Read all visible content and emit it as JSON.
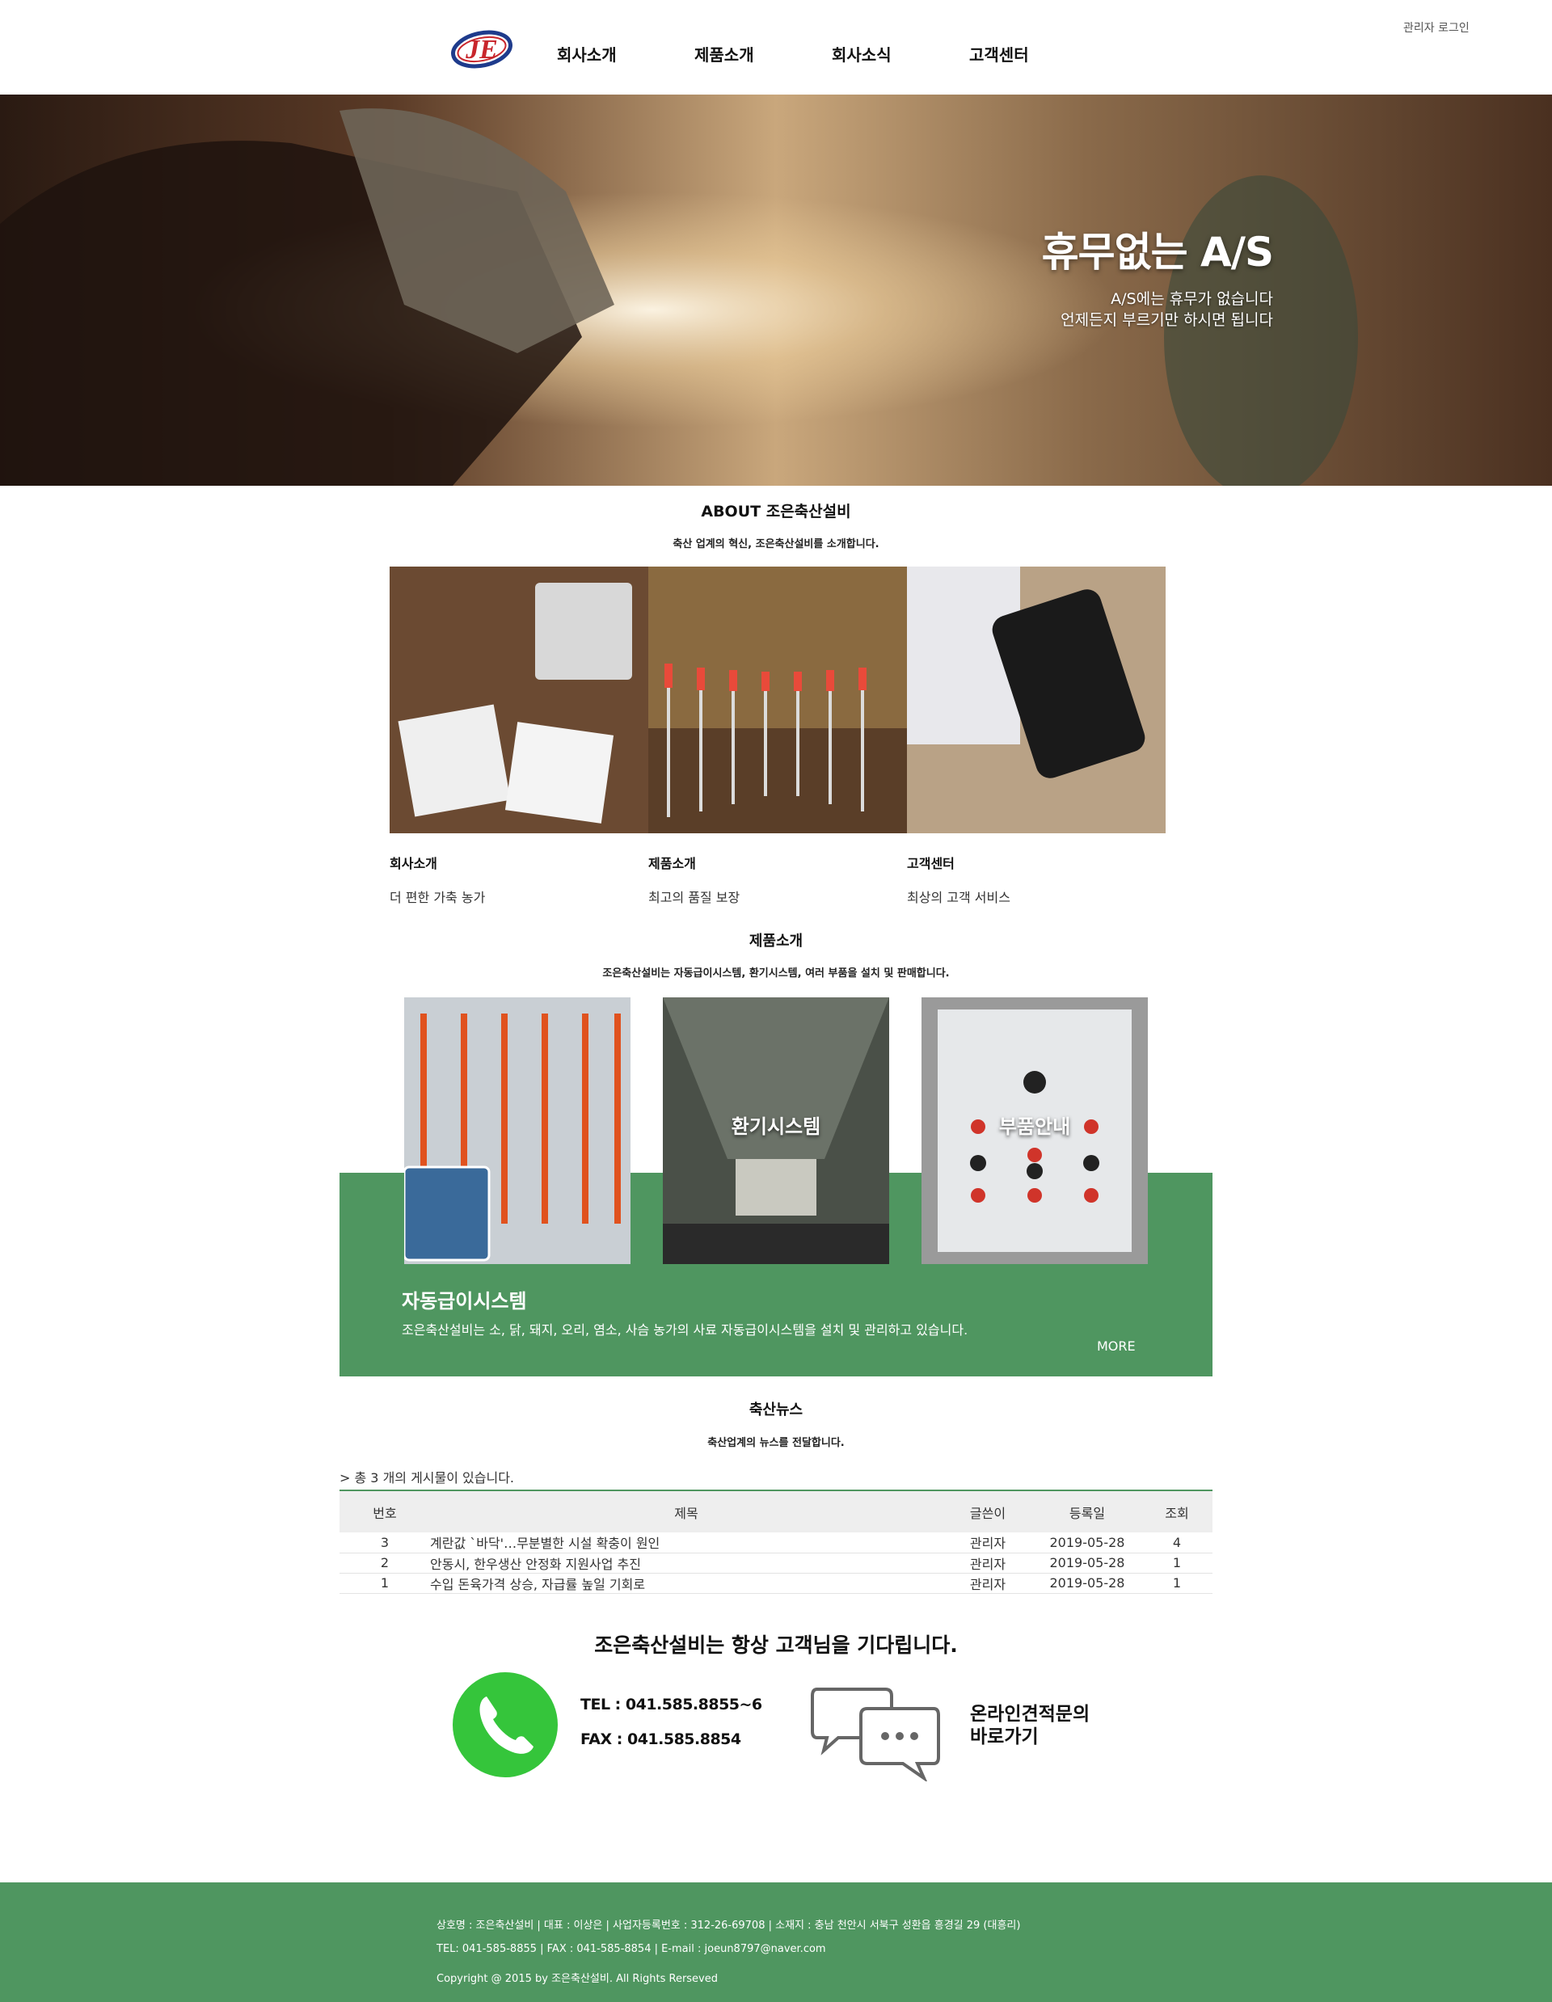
{
  "colors": {
    "brand_green": "#4f9660",
    "phone_green": "#35c53b",
    "table_header_bg": "#eeeeee"
  },
  "header": {
    "logo_text": "JE",
    "nav": [
      "회사소개",
      "제품소개",
      "회사소식",
      "고객센터"
    ],
    "admin_login": "관리자 로그인"
  },
  "hero": {
    "title": "휴무없는 A/S",
    "line1": "A/S에는 휴무가 없습니다",
    "line2": "언제든지 부르기만 하시면 됩니다"
  },
  "about": {
    "title": "ABOUT 조은축산설비",
    "subtitle": "축산 업계의 혁신, 조은축산설비를 소개합니다.",
    "items": [
      {
        "label": "회사소개",
        "desc": "더 편한 가축 농가"
      },
      {
        "label": "제품소개",
        "desc": "최고의 품질 보장"
      },
      {
        "label": "고객센터",
        "desc": "최상의 고객 서비스"
      }
    ]
  },
  "products": {
    "title": "제품소개",
    "subtitle": "조은축산설비는 자동급이시스템, 환기시스템, 여러 부품을 설치 및 판매합니다.",
    "items": [
      {
        "label": ""
      },
      {
        "label": "환기시스템"
      },
      {
        "label": "부품안내"
      }
    ],
    "featured_title": "자동급이시스템",
    "featured_desc": "조은축산설비는 소, 닭, 돼지, 오리, 염소, 사슴 농가의 사료 자동급이시스템을 설치 및 관리하고 있습니다.",
    "more": "MORE"
  },
  "news": {
    "title": "축산뉴스",
    "subtitle": "축산업계의 뉴스를 전달합니다.",
    "count_text": "> 총 3 개의 게시물이 있습니다.",
    "columns": [
      "번호",
      "제목",
      "글쓴이",
      "등록일",
      "조회"
    ],
    "rows": [
      {
        "no": "3",
        "subject": "계란값 `바닥'…무분별한 시설 확충이 원인",
        "writer": "관리자",
        "date": "2019-05-28",
        "hits": "4"
      },
      {
        "no": "2",
        "subject": "안동시, 한우생산 안정화 지원사업 추진",
        "writer": "관리자",
        "date": "2019-05-28",
        "hits": "1"
      },
      {
        "no": "1",
        "subject": "수입 돈육가격 상승, 자급률 높일 기회로",
        "writer": "관리자",
        "date": "2019-05-28",
        "hits": "1"
      }
    ]
  },
  "contact": {
    "title": "조은축산설비는 항상 고객님을 기다립니다.",
    "tel": "TEL : 041.585.8855~6",
    "fax": "FAX : 041.585.8854",
    "online_line1": "온라인견적문의",
    "online_line2": "바로가기",
    "phone_icon": "phone-icon",
    "chat_icon": "chat-bubbles-icon"
  },
  "footer": {
    "line1": "상호명 : 조은축산설비 | 대표 : 이상은 | 사업자등록번호 : 312-26-69708 | 소재지 : 충남 천안시 서북구 성환읍 흥경길 29 (대흥리)",
    "line2": "TEL: 041-585-8855 | FAX : 041-585-8854 | E-mail : joeun8797@naver.com",
    "line3": "Copyright @ 2015 by 조은축산설비. All Rights Rerseved"
  }
}
